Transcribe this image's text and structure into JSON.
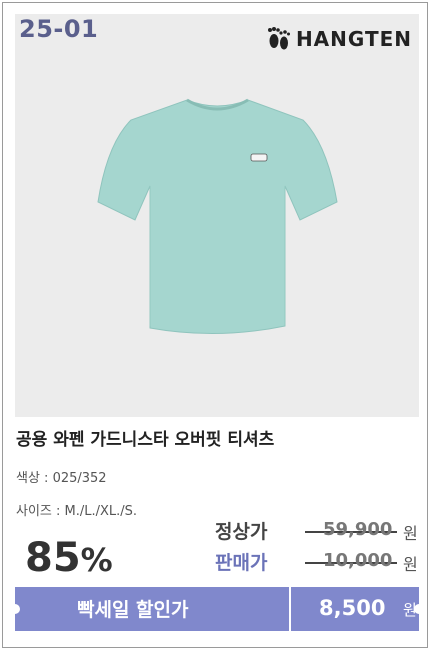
{
  "badge": {
    "code": "25-01"
  },
  "brand": {
    "name": "HANGTEN",
    "logo_icon": "footprints-icon"
  },
  "product": {
    "title": "공용 와펜 가드니스타 오버핏 티셔츠",
    "color_label": "색상 : 025/352",
    "size_label": "사이즈 : M./L./XL./S.",
    "image_icon": "tshirt-icon",
    "shirt_color": "#a5d6cf"
  },
  "pricing": {
    "discount": "85",
    "discount_unit": "%",
    "regular_label": "정상가",
    "regular_price": "59,900",
    "sale_label": "판매가",
    "sale_price": "10,000",
    "currency": "원"
  },
  "promo_bar": {
    "label": "빡세일 할인가",
    "price": "8,500",
    "currency": "원",
    "accent": "#8088cc"
  }
}
